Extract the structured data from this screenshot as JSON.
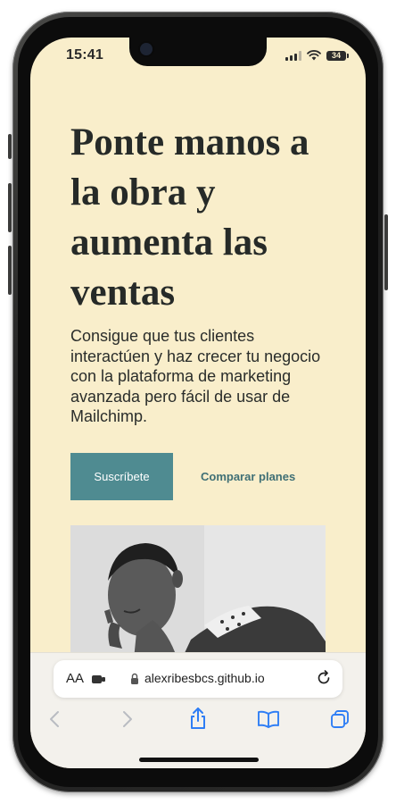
{
  "status_bar": {
    "time": "15:41",
    "battery": "34"
  },
  "hero": {
    "heading": "Ponte manos a la obra y aumenta las ventas",
    "intro": "Consigue que tus clientes interactúen y haz crecer tu negocio con la plataforma de marketing avanzada pero fácil de usar de Mailchimp.",
    "subscribe_label": "Suscríbete",
    "compare_label": "Comparar planes"
  },
  "browser": {
    "text_size_label": "AA",
    "url": "alexribesbcs.github.io"
  },
  "colors": {
    "page_background": "#f9eecb",
    "button": "#4f8b91",
    "link": "#3f6f75",
    "browser_accent": "#2f7ef5"
  }
}
